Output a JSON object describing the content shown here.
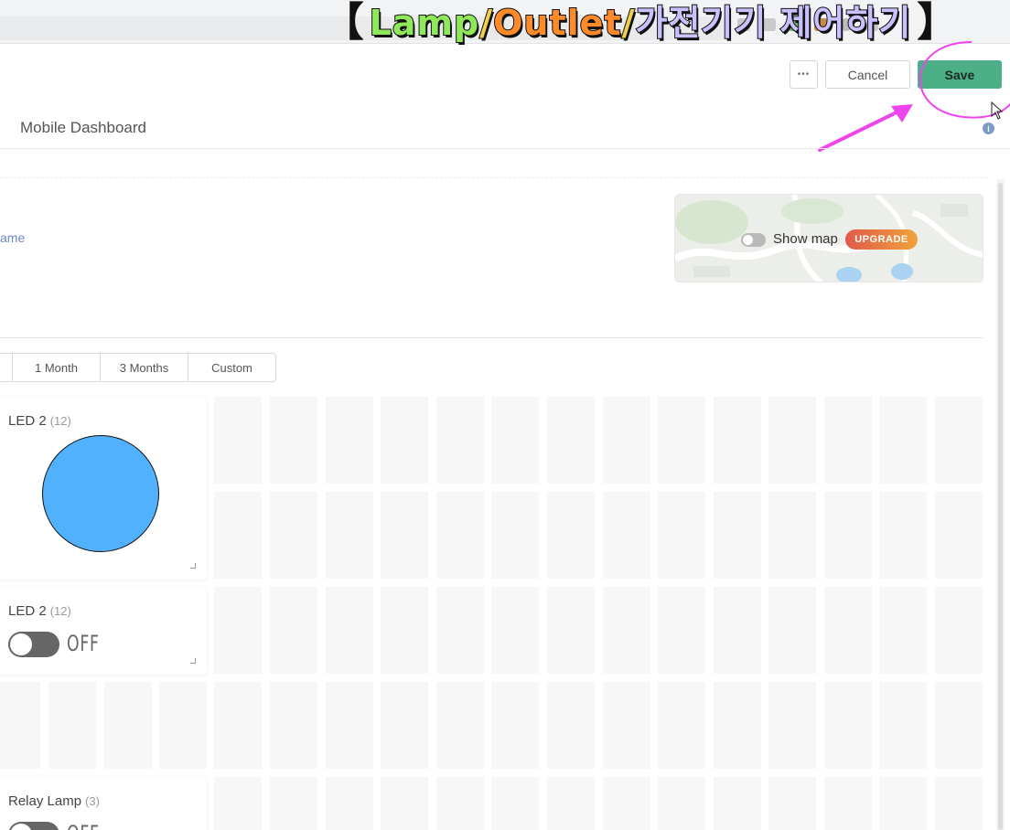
{
  "caption": {
    "bracket_open": "【",
    "part1": "Lamp",
    "sep1": "/",
    "part2": "Outlet",
    "sep2": "/",
    "part3": "가전기기 제어하기",
    "bracket_close": "】"
  },
  "header": {
    "more_label": "•••",
    "cancel_label": "Cancel",
    "save_label": "Save"
  },
  "tabs": {
    "mobile_dashboard": "Mobile Dashboard"
  },
  "device": {
    "name_fragment": "ame"
  },
  "map": {
    "show_map_label": "Show map",
    "show_map_enabled": false,
    "upgrade_label": "UPGRADE"
  },
  "time_ranges": [
    "",
    "1 Month",
    "3 Months",
    "Custom"
  ],
  "widgets": [
    {
      "title": "LED 2",
      "count": "(12)",
      "type": "led",
      "color": "#51b1ff"
    },
    {
      "title": "LED 2",
      "count": "(12)",
      "type": "switch",
      "state": "OFF"
    },
    {
      "title": "Relay Lamp",
      "count": "(3)",
      "type": "switch",
      "state": "OFF"
    }
  ],
  "colors": {
    "save_button": "#4caf87",
    "annotation": "#ee44ee",
    "led": "#51b1ff"
  }
}
